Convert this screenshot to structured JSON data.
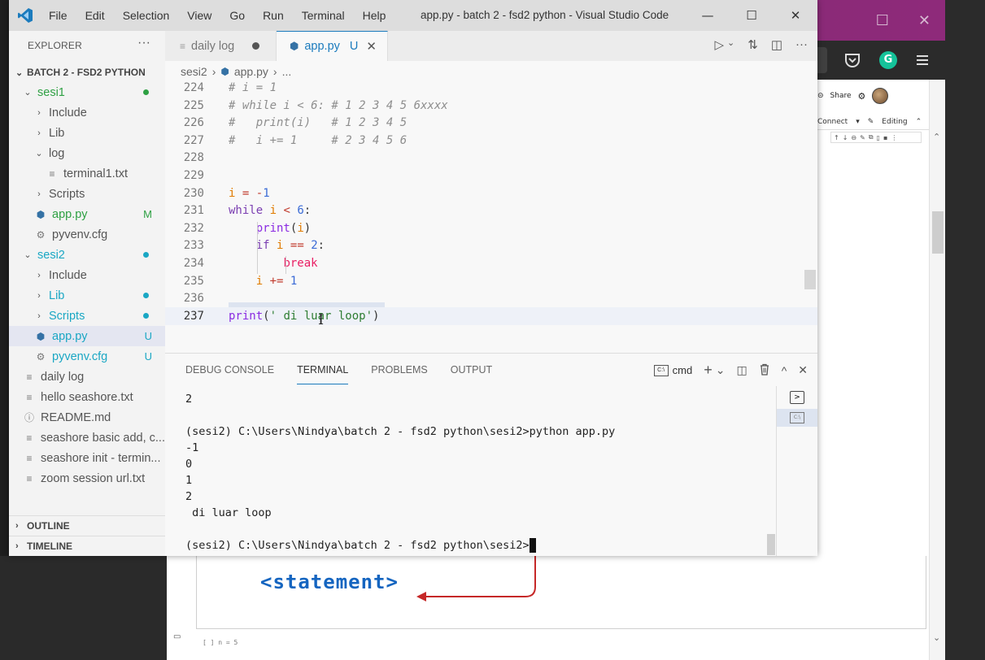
{
  "window": {
    "title": "app.py - batch 2 - fsd2 python - Visual Studio Code",
    "menu": [
      "File",
      "Edit",
      "Selection",
      "View",
      "Go",
      "Run",
      "Terminal",
      "Help"
    ],
    "controls": {
      "minimize": "—",
      "maximize": "☐",
      "close": "✕"
    }
  },
  "explorer": {
    "header": "EXPLORER",
    "more": "···",
    "root": "BATCH 2 - FSD2 PYTHON",
    "items": [
      {
        "label": "sesi1",
        "depth": 1,
        "kind": "folder-open",
        "color": "#2ea043",
        "status": "dot",
        "status_color": "#2ea043"
      },
      {
        "label": "Include",
        "depth": 2,
        "kind": "folder",
        "color": "#555555"
      },
      {
        "label": "Lib",
        "depth": 2,
        "kind": "folder",
        "color": "#555555"
      },
      {
        "label": "log",
        "depth": 2,
        "kind": "folder-open",
        "color": "#555555"
      },
      {
        "label": "terminal1.txt",
        "depth": 3,
        "kind": "file-text",
        "color": "#555555"
      },
      {
        "label": "Scripts",
        "depth": 2,
        "kind": "folder",
        "color": "#555555"
      },
      {
        "label": "app.py",
        "depth": 2,
        "kind": "file-python",
        "color": "#2ea043",
        "status": "M",
        "status_color": "#2ea043"
      },
      {
        "label": "pyvenv.cfg",
        "depth": 2,
        "kind": "file-gear",
        "color": "#555555"
      },
      {
        "label": "sesi2",
        "depth": 1,
        "kind": "folder-open",
        "color": "#1aa7c4",
        "status": "dot",
        "status_color": "#1aa7c4"
      },
      {
        "label": "Include",
        "depth": 2,
        "kind": "folder",
        "color": "#555555"
      },
      {
        "label": "Lib",
        "depth": 2,
        "kind": "folder",
        "color": "#1aa7c4",
        "status": "dot",
        "status_color": "#1aa7c4"
      },
      {
        "label": "Scripts",
        "depth": 2,
        "kind": "folder",
        "color": "#1aa7c4",
        "status": "dot",
        "status_color": "#1aa7c4"
      },
      {
        "label": "app.py",
        "depth": 2,
        "kind": "file-python",
        "color": "#1aa7c4",
        "status": "U",
        "status_color": "#1aa7c4",
        "selected": true
      },
      {
        "label": "pyvenv.cfg",
        "depth": 2,
        "kind": "file-gear",
        "color": "#1aa7c4",
        "status": "U",
        "status_color": "#1aa7c4"
      },
      {
        "label": "daily log",
        "depth": 1,
        "kind": "file-text",
        "color": "#555555"
      },
      {
        "label": "hello seashore.txt",
        "depth": 1,
        "kind": "file-text",
        "color": "#555555"
      },
      {
        "label": "README.md",
        "depth": 1,
        "kind": "file-info",
        "color": "#555555"
      },
      {
        "label": "seashore basic add, c...",
        "depth": 1,
        "kind": "file-text",
        "color": "#555555"
      },
      {
        "label": "seashore init - termin...",
        "depth": 1,
        "kind": "file-text",
        "color": "#555555"
      },
      {
        "label": "zoom session url.txt",
        "depth": 1,
        "kind": "file-text",
        "color": "#555555"
      }
    ],
    "outline": "OUTLINE",
    "timeline": "TIMELINE"
  },
  "tabs": {
    "daily": "daily log",
    "app": "app.py",
    "app_status": "U",
    "close": "✕"
  },
  "breadcrumb": {
    "folder": "sesi2",
    "file": "app.py",
    "rest": "..."
  },
  "code": [
    {
      "n": "224",
      "tokens": [
        [
          "cmt",
          "# i = 1"
        ]
      ]
    },
    {
      "n": "225",
      "tokens": [
        [
          "cmt",
          "# while i < 6: # 1 2 3 4 5 6xxxx"
        ]
      ]
    },
    {
      "n": "226",
      "tokens": [
        [
          "cmt",
          "#   print(i)   # 1 2 3 4 5"
        ]
      ]
    },
    {
      "n": "227",
      "tokens": [
        [
          "cmt",
          "#   i += 1     # 2 3 4 5 6"
        ]
      ]
    },
    {
      "n": "228",
      "tokens": []
    },
    {
      "n": "229",
      "tokens": []
    },
    {
      "n": "230",
      "tokens": [
        [
          "var",
          "i"
        ],
        [
          "plain",
          " "
        ],
        [
          "op",
          "="
        ],
        [
          "plain",
          " "
        ],
        [
          "op",
          "-"
        ],
        [
          "num",
          "1"
        ]
      ]
    },
    {
      "n": "231",
      "tokens": [
        [
          "kw",
          "while"
        ],
        [
          "plain",
          " "
        ],
        [
          "var",
          "i"
        ],
        [
          "plain",
          " "
        ],
        [
          "op",
          "<"
        ],
        [
          "plain",
          " "
        ],
        [
          "num",
          "6"
        ],
        [
          "plain",
          ":"
        ]
      ]
    },
    {
      "n": "232",
      "tokens": [
        [
          "plain",
          "    "
        ],
        [
          "fn",
          "print"
        ],
        [
          "plain",
          "("
        ],
        [
          "var",
          "i"
        ],
        [
          "plain",
          ")"
        ]
      ]
    },
    {
      "n": "233",
      "tokens": [
        [
          "plain",
          "    "
        ],
        [
          "kw",
          "if"
        ],
        [
          "plain",
          " "
        ],
        [
          "var",
          "i"
        ],
        [
          "plain",
          " "
        ],
        [
          "op",
          "=="
        ],
        [
          "plain",
          " "
        ],
        [
          "num",
          "2"
        ],
        [
          "plain",
          ":"
        ]
      ]
    },
    {
      "n": "234",
      "tokens": [
        [
          "plain",
          "        "
        ],
        [
          "brk",
          "break"
        ]
      ]
    },
    {
      "n": "235",
      "tokens": [
        [
          "plain",
          "    "
        ],
        [
          "var",
          "i"
        ],
        [
          "plain",
          " "
        ],
        [
          "op",
          "+="
        ],
        [
          "plain",
          " "
        ],
        [
          "num",
          "1"
        ]
      ]
    },
    {
      "n": "236",
      "tokens": []
    },
    {
      "n": "237",
      "tokens": [
        [
          "fn",
          "print"
        ],
        [
          "plain",
          "("
        ],
        [
          "str",
          "' di luar loop'"
        ],
        [
          "plain",
          ")"
        ]
      ],
      "current": true
    }
  ],
  "panel": {
    "tabs": [
      "DEBUG CONSOLE",
      "TERMINAL",
      "PROBLEMS",
      "OUTPUT"
    ],
    "active": "TERMINAL",
    "profile": "cmd",
    "actions": {
      "add": "+",
      "dropdown": "⌄",
      "split": "◫",
      "trash": "🗑",
      "maximize": "^",
      "close": "✕"
    }
  },
  "terminal": {
    "lines": [
      "2",
      "",
      "(sesi2) C:\\Users\\Nindya\\batch 2 - fsd2 python\\sesi2>python app.py",
      "-1",
      "0",
      "1",
      "2",
      " di luar loop",
      "",
      "(sesi2) C:\\Users\\Nindya\\batch 2 - fsd2 python\\sesi2>"
    ]
  },
  "browser": {
    "share": "Share",
    "connect": "Connect",
    "editing": "Editing",
    "statement": "<statement>",
    "next_cell": "[ ]  n = 5"
  },
  "colors": {
    "accent": "#1b7bbd",
    "modified": "#2ea043",
    "untracked": "#1aa7c4",
    "browser_frame": "#7b2a6e"
  }
}
